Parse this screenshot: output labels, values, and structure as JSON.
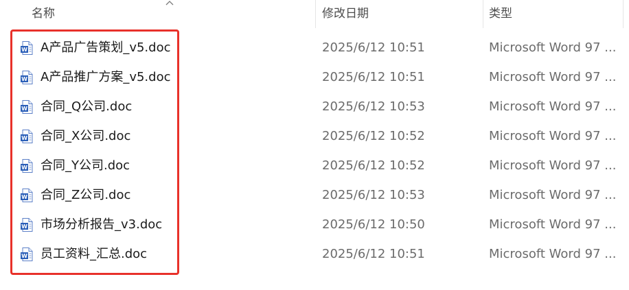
{
  "columns": {
    "name": "名称",
    "modified": "修改日期",
    "type": "类型"
  },
  "sort_icon": "chevron-up-icon",
  "file_icon": "word-doc-icon",
  "colors": {
    "highlight_border": "#e8312a",
    "word_blue": "#2b5fb8"
  },
  "files": [
    {
      "name": "A产品广告策划_v5.doc",
      "modified": "2025/6/12 10:51",
      "type": "Microsoft Word 97 ..."
    },
    {
      "name": "A产品推广方案_v5.doc",
      "modified": "2025/6/12 10:51",
      "type": "Microsoft Word 97 ..."
    },
    {
      "name": "合同_Q公司.doc",
      "modified": "2025/6/12 10:53",
      "type": "Microsoft Word 97 ..."
    },
    {
      "name": "合同_X公司.doc",
      "modified": "2025/6/12 10:52",
      "type": "Microsoft Word 97 ..."
    },
    {
      "name": "合同_Y公司.doc",
      "modified": "2025/6/12 10:52",
      "type": "Microsoft Word 97 ..."
    },
    {
      "name": "合同_Z公司.doc",
      "modified": "2025/6/12 10:53",
      "type": "Microsoft Word 97 ..."
    },
    {
      "name": "市场分析报告_v3.doc",
      "modified": "2025/6/12 10:50",
      "type": "Microsoft Word 97 ..."
    },
    {
      "name": "员工资料_汇总.doc",
      "modified": "2025/6/12 10:51",
      "type": "Microsoft Word 97 ..."
    }
  ]
}
